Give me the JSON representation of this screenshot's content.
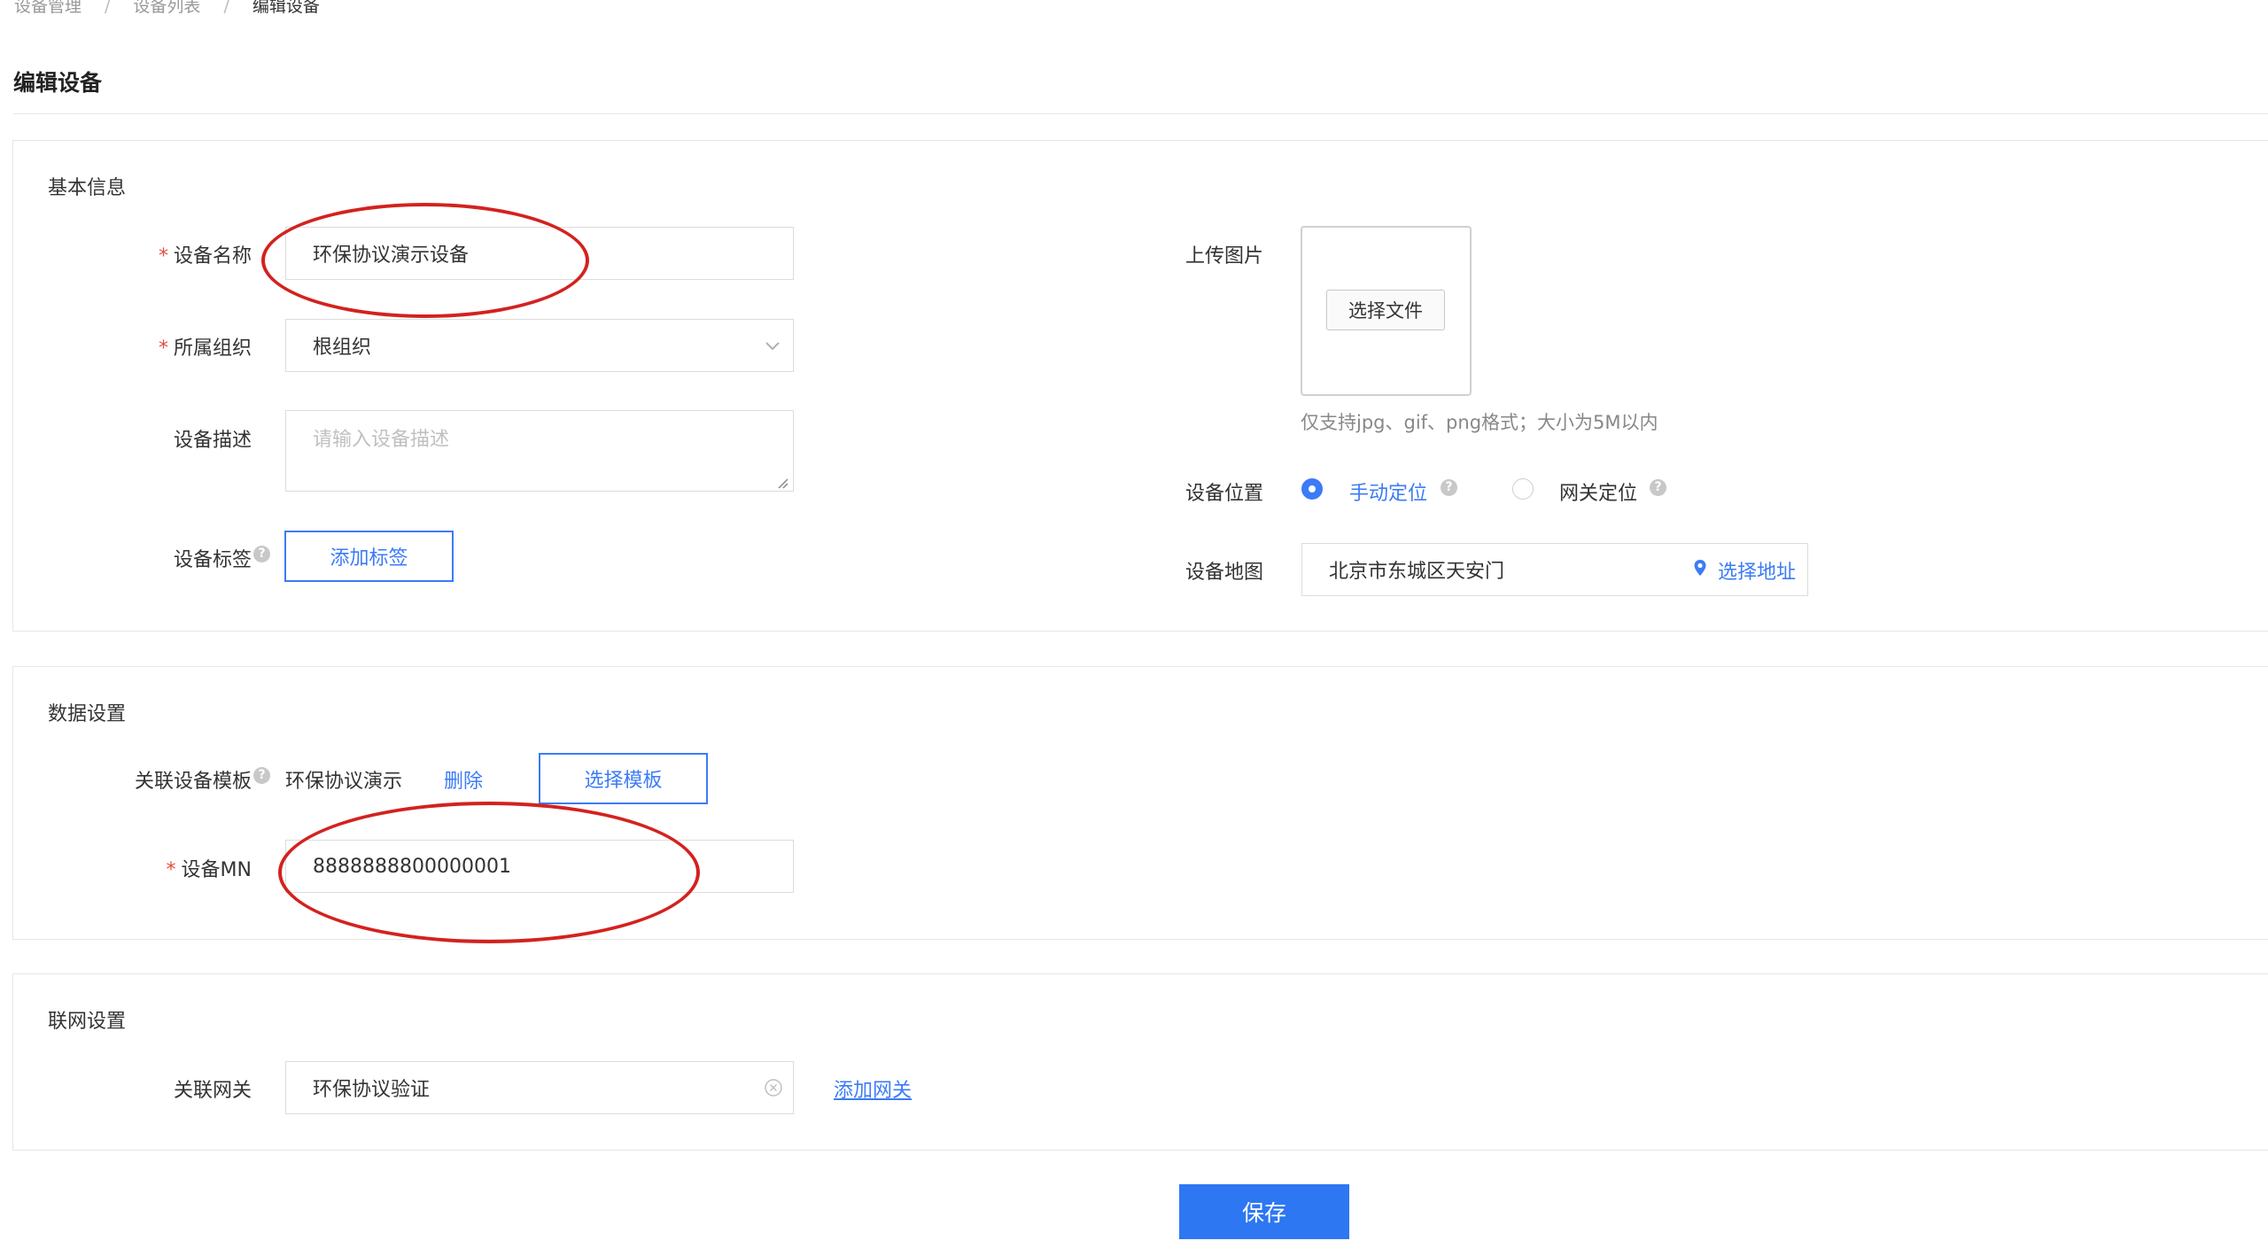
{
  "breadcrumb": [
    "设备管理",
    "设备列表",
    "编辑设备"
  ],
  "page_title": "编辑设备",
  "basic": {
    "section_title": "基本信息",
    "name_label": "设备名称",
    "name_value": "环保协议演示设备",
    "org_label": "所属组织",
    "org_value": "根组织",
    "desc_label": "设备描述",
    "desc_placeholder": "请输入设备描述",
    "tag_label": "设备标签",
    "tag_button": "添加标签",
    "upload_label": "上传图片",
    "file_button": "选择文件",
    "upload_hint": "仅支持jpg、gif、png格式；大小为5M以内",
    "location_label": "设备位置",
    "location_options": [
      "手动定位",
      "网关定位"
    ],
    "location_selected": "手动定位",
    "map_label": "设备地图",
    "map_value": "北京市东城区天安门",
    "map_button": "选择地址"
  },
  "data_settings": {
    "section_title": "数据设置",
    "template_label": "关联设备模板",
    "template_value": "环保协议演示",
    "delete_link": "删除",
    "choose_template_button": "选择模板",
    "mn_label": "设备MN",
    "mn_value": "8888888800000001"
  },
  "network": {
    "section_title": "联网设置",
    "gateway_label": "关联网关",
    "gateway_value": "环保协议验证",
    "add_gateway_link": "添加网关"
  },
  "save_button": "保存",
  "colors": {
    "primary": "#3c7bf7",
    "required": "#e84a3c",
    "annotation": "#d3221f"
  }
}
